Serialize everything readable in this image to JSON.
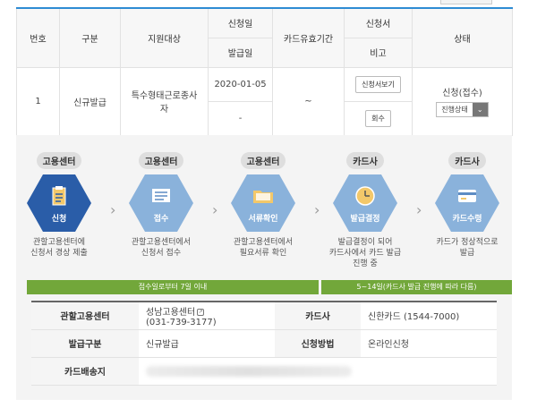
{
  "table": {
    "headers": {
      "no": "번호",
      "type": "구분",
      "target": "지원대상",
      "apply_date": "신청일",
      "issue_date": "발급일",
      "card_valid": "카드유효기간",
      "application": "신청서",
      "remark": "비고",
      "status": "상태"
    },
    "row": {
      "no": "1",
      "type": "신규발급",
      "target": "특수형태근로종사자",
      "apply_date": "2020-01-05",
      "issue_date": "-",
      "card_valid": "~",
      "view_button": "신청서보기",
      "recall_button": "회수",
      "status": "신청(접수)",
      "status_select": "진행상태",
      "status_arrow": "⌄"
    }
  },
  "process": {
    "steps": [
      {
        "label": "고용센터",
        "title": "신청",
        "icon": "clipboard-icon",
        "desc": [
          "관할고용센터에",
          "신청서 경상 제출"
        ],
        "active": true
      },
      {
        "label": "고용센터",
        "title": "접수",
        "icon": "document-list-icon",
        "desc": [
          "관할고용센터에서",
          "신청서 접수"
        ],
        "active": false
      },
      {
        "label": "고용센터",
        "title": "서류확인",
        "icon": "folder-icon",
        "desc": [
          "관할고용센터에서",
          "필요서류 확인"
        ],
        "active": false
      },
      {
        "label": "카드사",
        "title": "발급결정",
        "icon": "clock-icon",
        "desc": [
          "발급결정이 되어",
          "카드사에서 카드 발급",
          "진행 중"
        ],
        "active": false
      },
      {
        "label": "카드사",
        "title": "카드수령",
        "icon": "card-icon",
        "desc": [
          "카드가 정상적으로",
          "발급"
        ],
        "active": false
      }
    ],
    "chevron": "›",
    "bars": {
      "left": "접수일로부터 7일 이내",
      "right": "5~14일(카드사 발급 진행에 따라 다름)"
    }
  },
  "info": {
    "center_label": "관할고용센터",
    "center_name": "성남고용센터",
    "center_phone": "(031-739-3177)",
    "card_label": "카드사",
    "card_value": "신한카드 (1544-7000)",
    "issue_type_label": "발급구분",
    "issue_type_value": "신규발급",
    "method_label": "신청방법",
    "method_value": "온라인신청",
    "delivery_label": "카드배송지"
  },
  "colors": {
    "accent_blue": "#2a5da8",
    "hex_light": "#8ab2db",
    "bar_green": "#72a73a"
  }
}
